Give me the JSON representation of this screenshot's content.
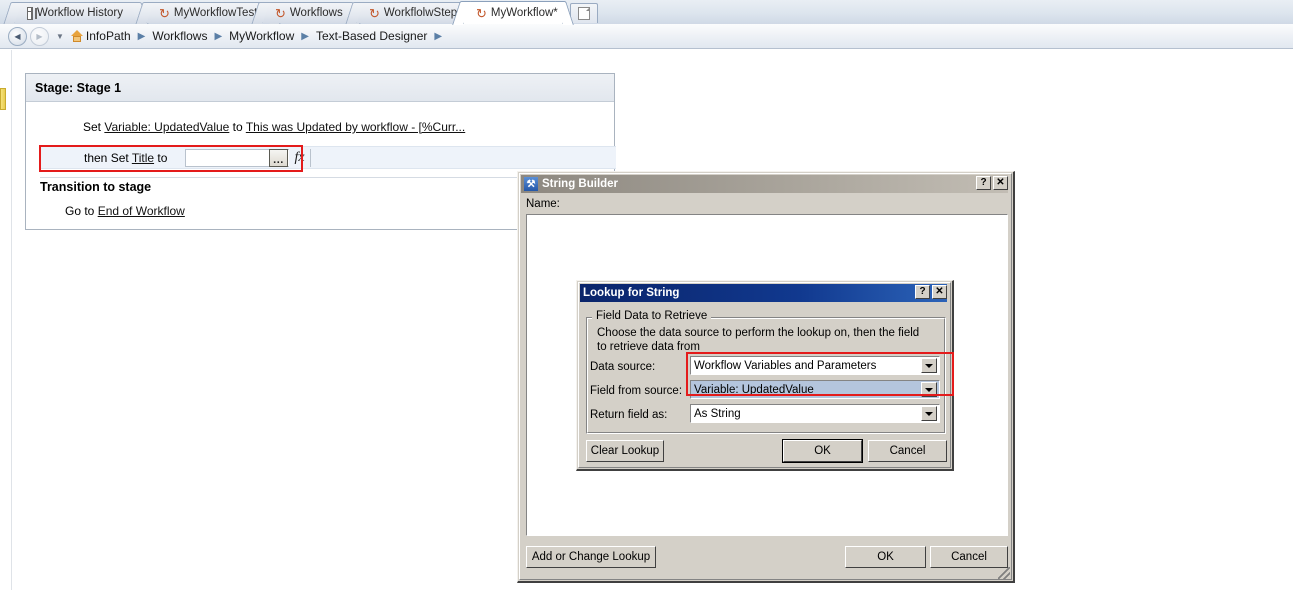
{
  "tabs": [
    {
      "label": "Workflow History",
      "icon": "grid-icon",
      "active": false
    },
    {
      "label": "MyWorkflowTest",
      "icon": "swirl-icon",
      "active": false
    },
    {
      "label": "Workflows",
      "icon": "swirl-icon",
      "active": false
    },
    {
      "label": "WorkflolwStep",
      "icon": "swirl-icon",
      "active": false
    },
    {
      "label": "MyWorkflow*",
      "icon": "swirl-icon",
      "active": true
    }
  ],
  "newtab": {
    "icon": "new-page-icon"
  },
  "breadcrumb": {
    "back_icon": "back-arrow-icon",
    "forward_icon": "forward-arrow-icon",
    "dropdown_icon": "chevron-down-icon",
    "home_icon": "home-icon",
    "items": [
      "InfoPath",
      "Workflows",
      "MyWorkflow",
      "Text-Based Designer"
    ],
    "separator": "▶"
  },
  "designer": {
    "stage_header": "Stage: Stage 1",
    "set_variable_line": "Set Variable: UpdatedValue to This was Updated by workflow - [%Curr...",
    "set_variable_parts": {
      "prefix": "Set ",
      "link1": "Variable: UpdatedValue",
      "mid": " to ",
      "link2": "This was Updated by workflow - [%Curr..."
    },
    "set_title_row": {
      "prefix": "then Set ",
      "link": "Title",
      "suffix": " to",
      "input_value": "",
      "ellipsis_label": "...",
      "fx_label": "fx"
    },
    "transition_header": "Transition to stage",
    "goto_line": {
      "prefix": "Go to ",
      "link": "End of Workflow"
    }
  },
  "string_builder": {
    "title": "String Builder",
    "icon": "wrench-icon",
    "help_label": "?",
    "close_label": "✕",
    "name_label": "Name:",
    "text_value": "",
    "add_lookup_label": "Add or Change Lookup",
    "ok_label": "OK",
    "cancel_label": "Cancel",
    "resize_grip": "resize-grip-icon"
  },
  "lookup_dialog": {
    "title": "Lookup for String",
    "help_label": "?",
    "close_label": "✕",
    "group_label": "Field Data to Retrieve",
    "description": "Choose the data source to perform the lookup on, then the field to retrieve data from",
    "fields": [
      {
        "label": "Data source:",
        "value": "Workflow Variables and Parameters",
        "selected": false
      },
      {
        "label": "Field from source:",
        "value": "Variable: UpdatedValue",
        "selected": true
      },
      {
        "label": "Return field as:",
        "value": "As String",
        "selected": false
      }
    ],
    "clear_label": "Clear Lookup",
    "ok_label": "OK",
    "cancel_label": "Cancel"
  },
  "annotations": {
    "highlight_color": "#e41b1b",
    "set_title_box": "red-highlight-set-title",
    "lookup_box": "red-highlight-lookup-fields"
  }
}
